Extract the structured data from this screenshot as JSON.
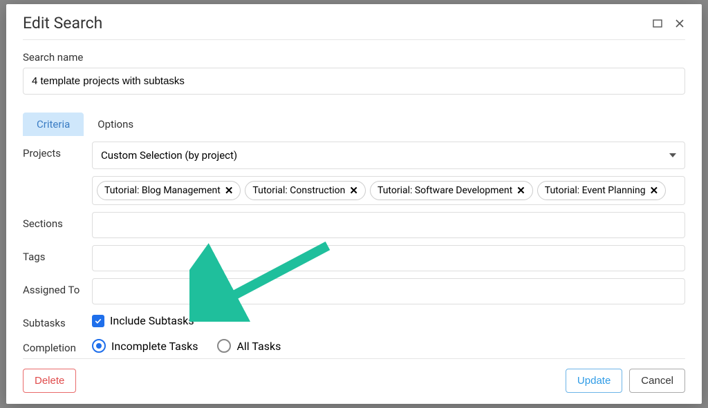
{
  "dialog": {
    "title": "Edit Search",
    "searchNameLabel": "Search name",
    "searchNameValue": "4 template projects with subtasks"
  },
  "tabs": {
    "criteria": "Criteria",
    "options": "Options"
  },
  "labels": {
    "projects": "Projects",
    "sections": "Sections",
    "tags": "Tags",
    "assignedTo": "Assigned To",
    "subtasks": "Subtasks",
    "completion": "Completion"
  },
  "projects": {
    "selected": "Custom Selection (by project)",
    "chips": [
      "Tutorial: Blog Management",
      "Tutorial: Construction",
      "Tutorial: Software Development",
      "Tutorial: Event Planning"
    ]
  },
  "subtasks": {
    "includeLabel": "Include Subtasks",
    "checked": true
  },
  "completion": {
    "incomplete": "Incomplete Tasks",
    "all": "All Tasks",
    "selected": "incomplete"
  },
  "buttons": {
    "delete": "Delete",
    "update": "Update",
    "cancel": "Cancel"
  }
}
